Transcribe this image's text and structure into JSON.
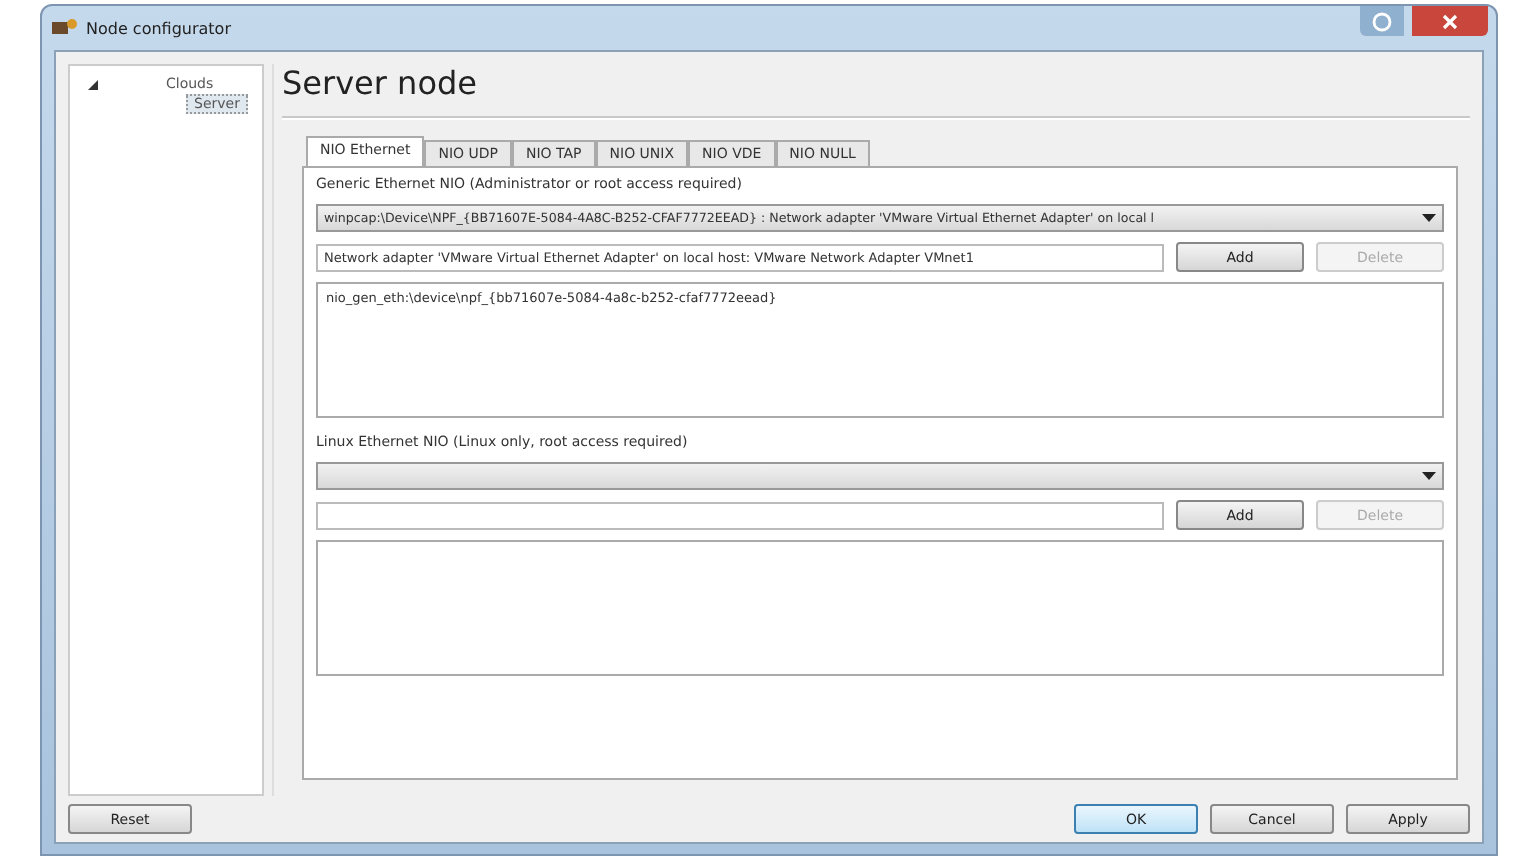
{
  "window": {
    "title": "Node configurator"
  },
  "tree": [
    {
      "label": "Clouds",
      "expanded": true,
      "selected": false,
      "children": [
        {
          "label": "Server",
          "selected": true
        }
      ]
    }
  ],
  "heading": "Server node",
  "tabs": [
    {
      "label": "NIO Ethernet",
      "selected": true
    },
    {
      "label": "NIO UDP",
      "selected": false
    },
    {
      "label": "NIO TAP",
      "selected": false
    },
    {
      "label": "NIO UNIX",
      "selected": false
    },
    {
      "label": "NIO VDE",
      "selected": false
    },
    {
      "label": "NIO NULL",
      "selected": false
    }
  ],
  "groups": [
    {
      "title": "Generic Ethernet NIO (Administrator or root access required)",
      "combo": "winpcap:\\Device\\NPF_{BB71607E-5084-4A8C-B252-CFAF7772EEAD} : Network adapter 'VMware Virtual Ethernet Adapter' on local l",
      "field": "Network adapter 'VMware Virtual Ethernet Adapter' on local host: VMware Network Adapter VMnet1",
      "add": {
        "label": "Add",
        "disabled": false
      },
      "delete": {
        "label": "Delete",
        "disabled": true
      },
      "items": [
        "nio_gen_eth:\\device\\npf_{bb71607e-5084-4a8c-b252-cfaf7772eead}"
      ]
    },
    {
      "title": "Linux Ethernet NIO (Linux only, root access required)",
      "add": {
        "label": "Add",
        "disabled": false
      },
      "delete": {
        "label": "Delete",
        "disabled": true
      }
    }
  ],
  "buttons": [
    {
      "label": "Reset",
      "kind": "left",
      "default": false
    },
    {
      "label": "OK",
      "kind": "right",
      "default": true
    },
    {
      "label": "Cancel",
      "kind": "right",
      "default": false
    },
    {
      "label": "Apply",
      "kind": "right",
      "default": false
    }
  ]
}
